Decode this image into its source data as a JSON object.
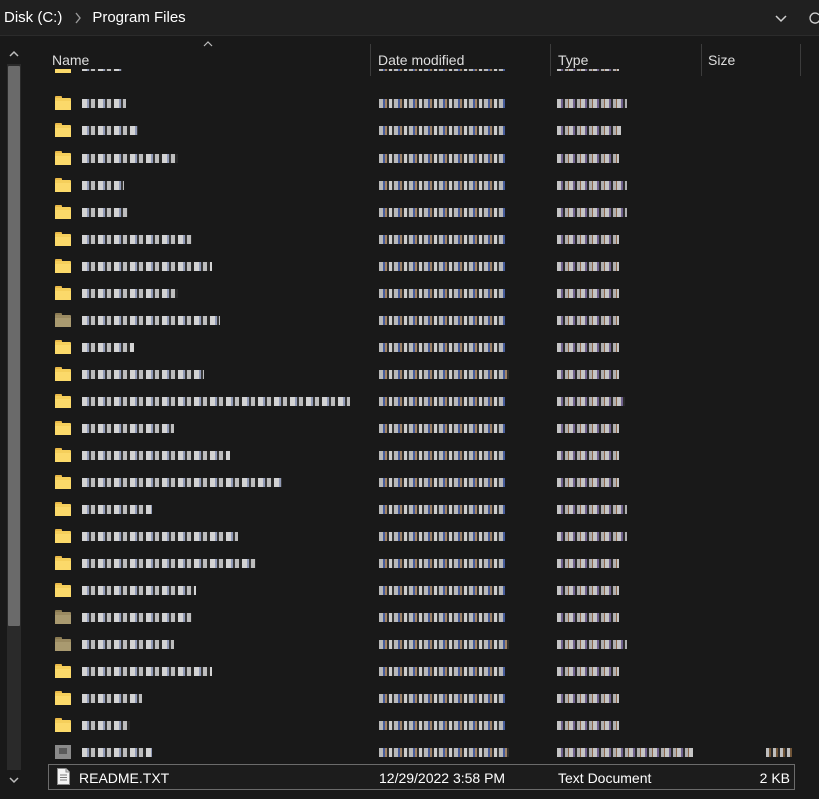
{
  "address": {
    "crumbs": [
      "Disk (C:)",
      "Program Files"
    ],
    "separator_icon": "chevron-right-icon",
    "history_icon": "chevron-down-icon",
    "refresh_icon": "refresh-icon"
  },
  "columns": {
    "name": "Name",
    "date_modified": "Date modified",
    "type": "Type",
    "size": "Size",
    "sorted_by": "Name",
    "sort_icon": "sort-ascending-icon"
  },
  "obscured_rows_note": "Rows above the selected file are pixelated/illegible in the screenshot; only their icons are reproduced.",
  "selected_file": {
    "name": "README.TXT",
    "date_modified": "12/29/2022 3:58 PM",
    "type": "Text Document",
    "size": "2 KB",
    "icon": "text-document-icon"
  },
  "colors": {
    "background": "#191919",
    "folder": "#f5cf5b",
    "text": "#ffffff"
  }
}
